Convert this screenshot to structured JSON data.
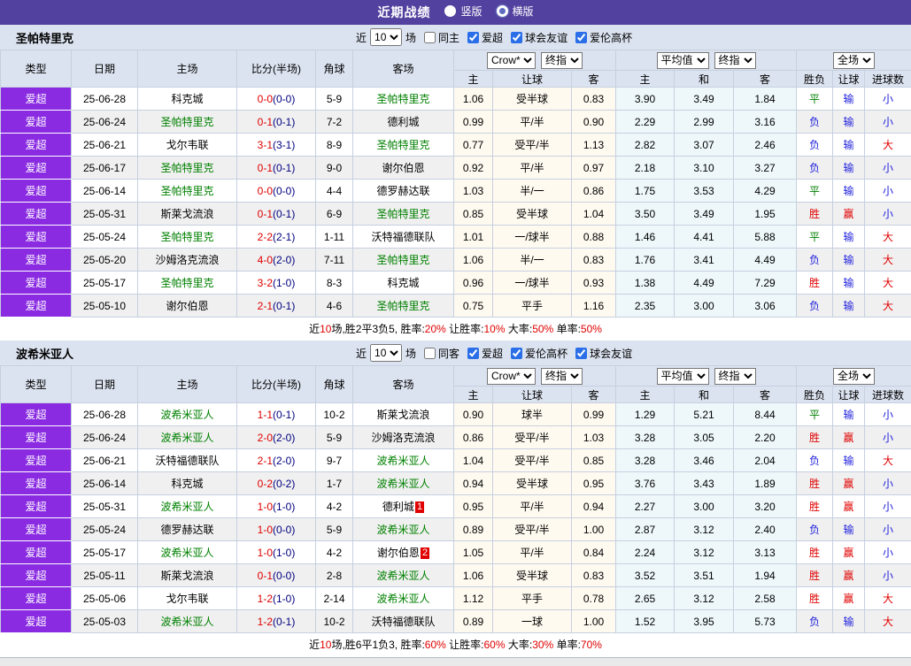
{
  "topbar": {
    "title": "近期战绩",
    "radios": [
      {
        "label": "竖版",
        "selected": true
      },
      {
        "label": "横版",
        "selected": false
      }
    ]
  },
  "table_header": {
    "left_cols": [
      "类型",
      "日期",
      "主场",
      "比分(半场)",
      "角球",
      "客场"
    ],
    "groups": [
      {
        "selects": [
          "Crow*",
          "终指"
        ]
      },
      {
        "selects": [
          "平均值",
          "终指"
        ]
      },
      {
        "selects": [
          "全场"
        ]
      }
    ],
    "sub_cols": [
      "主",
      "让球",
      "客",
      "主",
      "和",
      "客",
      "胜负",
      "让球",
      "进球数"
    ]
  },
  "colors": {
    "topbar": "#52419e",
    "league_badge": "#8a2be2",
    "header_bg": "#dce3f0",
    "border": "#c6d0e0",
    "self_team": "#008000",
    "score": "#e00000",
    "halftime": "#000080",
    "win": "#e00000",
    "draw": "#008000",
    "loss": "#2222dd",
    "odds_bg": "#fffaf0",
    "avg_bg": "#eef8fb"
  },
  "sections": [
    {
      "team": "圣帕特里克",
      "controls": {
        "prefix": "近",
        "count": "10",
        "suffix": "场",
        "checkboxes": [
          {
            "label": "同主",
            "checked": false
          },
          {
            "label": "爱超",
            "checked": true
          },
          {
            "label": "球会友谊",
            "checked": true
          },
          {
            "label": "爱伦高杯",
            "checked": true
          }
        ]
      },
      "rows": [
        {
          "league": "爱超",
          "date": "25-06-28",
          "home": {
            "name": "科克城",
            "self": false
          },
          "score": "0-0",
          "half": "0-0",
          "corner": "5-9",
          "away": {
            "name": "圣帕特里克",
            "self": true
          },
          "odds": [
            "1.06",
            "受半球",
            "0.83"
          ],
          "avg": [
            "3.90",
            "3.49",
            "1.84"
          ],
          "res": [
            "平",
            "输",
            "小"
          ]
        },
        {
          "league": "爱超",
          "date": "25-06-24",
          "home": {
            "name": "圣帕特里克",
            "self": true
          },
          "score": "0-1",
          "half": "0-1",
          "corner": "7-2",
          "away": {
            "name": "德利城",
            "self": false
          },
          "odds": [
            "0.99",
            "平/半",
            "0.90"
          ],
          "avg": [
            "2.29",
            "2.99",
            "3.16"
          ],
          "res": [
            "负",
            "输",
            "小"
          ]
        },
        {
          "league": "爱超",
          "date": "25-06-21",
          "home": {
            "name": "戈尔韦联",
            "self": false
          },
          "score": "3-1",
          "half": "3-1",
          "corner": "8-9",
          "away": {
            "name": "圣帕特里克",
            "self": true
          },
          "odds": [
            "0.77",
            "受平/半",
            "1.13"
          ],
          "avg": [
            "2.82",
            "3.07",
            "2.46"
          ],
          "res": [
            "负",
            "输",
            "大"
          ]
        },
        {
          "league": "爱超",
          "date": "25-06-17",
          "home": {
            "name": "圣帕特里克",
            "self": true
          },
          "score": "0-1",
          "half": "0-1",
          "corner": "9-0",
          "away": {
            "name": "谢尔伯恩",
            "self": false
          },
          "odds": [
            "0.92",
            "平/半",
            "0.97"
          ],
          "avg": [
            "2.18",
            "3.10",
            "3.27"
          ],
          "res": [
            "负",
            "输",
            "小"
          ]
        },
        {
          "league": "爱超",
          "date": "25-06-14",
          "home": {
            "name": "圣帕特里克",
            "self": true
          },
          "score": "0-0",
          "half": "0-0",
          "corner": "4-4",
          "away": {
            "name": "德罗赫达联",
            "self": false
          },
          "odds": [
            "1.03",
            "半/一",
            "0.86"
          ],
          "avg": [
            "1.75",
            "3.53",
            "4.29"
          ],
          "res": [
            "平",
            "输",
            "小"
          ]
        },
        {
          "league": "爱超",
          "date": "25-05-31",
          "home": {
            "name": "斯莱戈流浪",
            "self": false
          },
          "score": "0-1",
          "half": "0-1",
          "corner": "6-9",
          "away": {
            "name": "圣帕特里克",
            "self": true
          },
          "odds": [
            "0.85",
            "受半球",
            "1.04"
          ],
          "avg": [
            "3.50",
            "3.49",
            "1.95"
          ],
          "res": [
            "胜",
            "赢",
            "小"
          ]
        },
        {
          "league": "爱超",
          "date": "25-05-24",
          "home": {
            "name": "圣帕特里克",
            "self": true
          },
          "score": "2-2",
          "half": "2-1",
          "corner": "1-11",
          "away": {
            "name": "沃特福德联队",
            "self": false
          },
          "odds": [
            "1.01",
            "一/球半",
            "0.88"
          ],
          "avg": [
            "1.46",
            "4.41",
            "5.88"
          ],
          "res": [
            "平",
            "输",
            "大"
          ]
        },
        {
          "league": "爱超",
          "date": "25-05-20",
          "home": {
            "name": "沙姆洛克流浪",
            "self": false
          },
          "score": "4-0",
          "half": "2-0",
          "corner": "7-11",
          "away": {
            "name": "圣帕特里克",
            "self": true
          },
          "odds": [
            "1.06",
            "半/一",
            "0.83"
          ],
          "avg": [
            "1.76",
            "3.41",
            "4.49"
          ],
          "res": [
            "负",
            "输",
            "大"
          ]
        },
        {
          "league": "爱超",
          "date": "25-05-17",
          "home": {
            "name": "圣帕特里克",
            "self": true
          },
          "score": "3-2",
          "half": "1-0",
          "corner": "8-3",
          "away": {
            "name": "科克城",
            "self": false
          },
          "odds": [
            "0.96",
            "一/球半",
            "0.93"
          ],
          "avg": [
            "1.38",
            "4.49",
            "7.29"
          ],
          "res": [
            "胜",
            "输",
            "大"
          ]
        },
        {
          "league": "爱超",
          "date": "25-05-10",
          "home": {
            "name": "谢尔伯恩",
            "self": false
          },
          "score": "2-1",
          "half": "0-1",
          "corner": "4-6",
          "away": {
            "name": "圣帕特里克",
            "self": true
          },
          "odds": [
            "0.75",
            "平手",
            "1.16"
          ],
          "avg": [
            "2.35",
            "3.00",
            "3.06"
          ],
          "res": [
            "负",
            "输",
            "大"
          ]
        }
      ],
      "summary": [
        [
          "近",
          false
        ],
        [
          "10",
          true
        ],
        [
          "场,胜2平3负5, 胜率:",
          false
        ],
        [
          "20%",
          true
        ],
        [
          " 让胜率:",
          false
        ],
        [
          "10%",
          true
        ],
        [
          " 大率:",
          false
        ],
        [
          "50%",
          true
        ],
        [
          " 单率:",
          false
        ],
        [
          "50%",
          true
        ]
      ]
    },
    {
      "team": "波希米亚人",
      "controls": {
        "prefix": "近",
        "count": "10",
        "suffix": "场",
        "checkboxes": [
          {
            "label": "同客",
            "checked": false
          },
          {
            "label": "爱超",
            "checked": true
          },
          {
            "label": "爱伦高杯",
            "checked": true
          },
          {
            "label": "球会友谊",
            "checked": true
          }
        ]
      },
      "rows": [
        {
          "league": "爱超",
          "date": "25-06-28",
          "home": {
            "name": "波希米亚人",
            "self": true
          },
          "score": "1-1",
          "half": "0-1",
          "corner": "10-2",
          "away": {
            "name": "斯莱戈流浪",
            "self": false
          },
          "odds": [
            "0.90",
            "球半",
            "0.99"
          ],
          "avg": [
            "1.29",
            "5.21",
            "8.44"
          ],
          "res": [
            "平",
            "输",
            "小"
          ]
        },
        {
          "league": "爱超",
          "date": "25-06-24",
          "home": {
            "name": "波希米亚人",
            "self": true
          },
          "score": "2-0",
          "half": "2-0",
          "corner": "5-9",
          "away": {
            "name": "沙姆洛克流浪",
            "self": false
          },
          "odds": [
            "0.86",
            "受平/半",
            "1.03"
          ],
          "avg": [
            "3.28",
            "3.05",
            "2.20"
          ],
          "res": [
            "胜",
            "赢",
            "小"
          ]
        },
        {
          "league": "爱超",
          "date": "25-06-21",
          "home": {
            "name": "沃特福德联队",
            "self": false
          },
          "score": "2-1",
          "half": "2-0",
          "corner": "9-7",
          "away": {
            "name": "波希米亚人",
            "self": true
          },
          "odds": [
            "1.04",
            "受平/半",
            "0.85"
          ],
          "avg": [
            "3.28",
            "3.46",
            "2.04"
          ],
          "res": [
            "负",
            "输",
            "大"
          ]
        },
        {
          "league": "爱超",
          "date": "25-06-14",
          "home": {
            "name": "科克城",
            "self": false
          },
          "score": "0-2",
          "half": "0-2",
          "corner": "1-7",
          "away": {
            "name": "波希米亚人",
            "self": true
          },
          "odds": [
            "0.94",
            "受半球",
            "0.95"
          ],
          "avg": [
            "3.76",
            "3.43",
            "1.89"
          ],
          "res": [
            "胜",
            "赢",
            "小"
          ]
        },
        {
          "league": "爱超",
          "date": "25-05-31",
          "home": {
            "name": "波希米亚人",
            "self": true
          },
          "score": "1-0",
          "half": "1-0",
          "corner": "4-2",
          "away": {
            "name": "德利城",
            "self": false,
            "badge": "1"
          },
          "odds": [
            "0.95",
            "平/半",
            "0.94"
          ],
          "avg": [
            "2.27",
            "3.00",
            "3.20"
          ],
          "res": [
            "胜",
            "赢",
            "小"
          ]
        },
        {
          "league": "爱超",
          "date": "25-05-24",
          "home": {
            "name": "德罗赫达联",
            "self": false
          },
          "score": "1-0",
          "half": "0-0",
          "corner": "5-9",
          "away": {
            "name": "波希米亚人",
            "self": true
          },
          "odds": [
            "0.89",
            "受平/半",
            "1.00"
          ],
          "avg": [
            "2.87",
            "3.12",
            "2.40"
          ],
          "res": [
            "负",
            "输",
            "小"
          ]
        },
        {
          "league": "爱超",
          "date": "25-05-17",
          "home": {
            "name": "波希米亚人",
            "self": true
          },
          "score": "1-0",
          "half": "1-0",
          "corner": "4-2",
          "away": {
            "name": "谢尔伯恩",
            "self": false,
            "badge": "2"
          },
          "odds": [
            "1.05",
            "平/半",
            "0.84"
          ],
          "avg": [
            "2.24",
            "3.12",
            "3.13"
          ],
          "res": [
            "胜",
            "赢",
            "小"
          ]
        },
        {
          "league": "爱超",
          "date": "25-05-11",
          "home": {
            "name": "斯莱戈流浪",
            "self": false
          },
          "score": "0-1",
          "half": "0-0",
          "corner": "2-8",
          "away": {
            "name": "波希米亚人",
            "self": true
          },
          "odds": [
            "1.06",
            "受半球",
            "0.83"
          ],
          "avg": [
            "3.52",
            "3.51",
            "1.94"
          ],
          "res": [
            "胜",
            "赢",
            "小"
          ]
        },
        {
          "league": "爱超",
          "date": "25-05-06",
          "home": {
            "name": "戈尔韦联",
            "self": false
          },
          "score": "1-2",
          "half": "1-0",
          "corner": "2-14",
          "away": {
            "name": "波希米亚人",
            "self": true
          },
          "odds": [
            "1.12",
            "平手",
            "0.78"
          ],
          "avg": [
            "2.65",
            "3.12",
            "2.58"
          ],
          "res": [
            "胜",
            "赢",
            "大"
          ]
        },
        {
          "league": "爱超",
          "date": "25-05-03",
          "home": {
            "name": "波希米亚人",
            "self": true
          },
          "score": "1-2",
          "half": "0-1",
          "corner": "10-2",
          "away": {
            "name": "沃特福德联队",
            "self": false
          },
          "odds": [
            "0.89",
            "一球",
            "1.00"
          ],
          "avg": [
            "1.52",
            "3.95",
            "5.73"
          ],
          "res": [
            "负",
            "输",
            "大"
          ]
        }
      ],
      "summary": [
        [
          "近",
          false
        ],
        [
          "10",
          true
        ],
        [
          "场,胜6平1负3, 胜率:",
          false
        ],
        [
          "60%",
          true
        ],
        [
          " 让胜率:",
          false
        ],
        [
          "60%",
          true
        ],
        [
          " 大率:",
          false
        ],
        [
          "30%",
          true
        ],
        [
          " 单率:",
          false
        ],
        [
          "70%",
          true
        ]
      ]
    }
  ]
}
